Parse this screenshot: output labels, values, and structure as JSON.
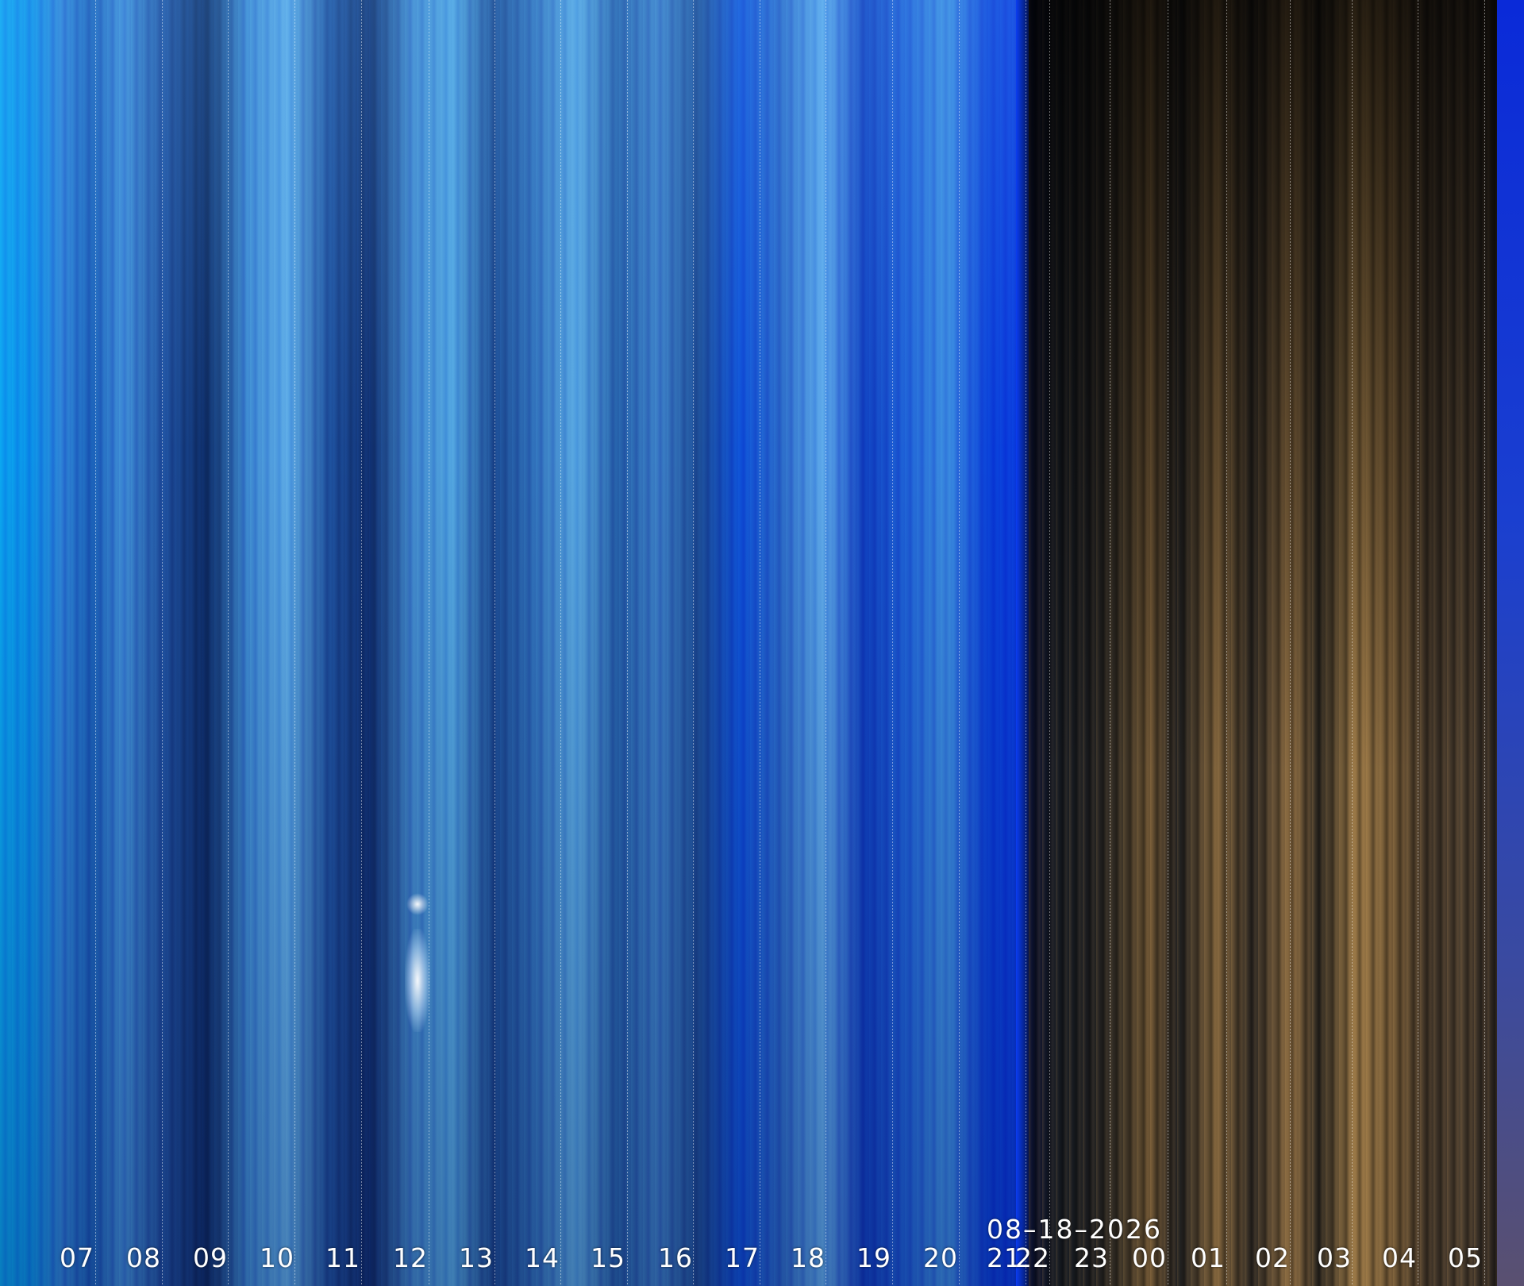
{
  "date_label": "08–18–2026",
  "hour_labels": [
    "07",
    "08",
    "09",
    "10",
    "11",
    "12",
    "13",
    "14",
    "15",
    "16",
    "17",
    "18",
    "19",
    "20",
    "21",
    "22",
    "23",
    "00",
    "01",
    "02",
    "03",
    "04",
    "05"
  ]
}
